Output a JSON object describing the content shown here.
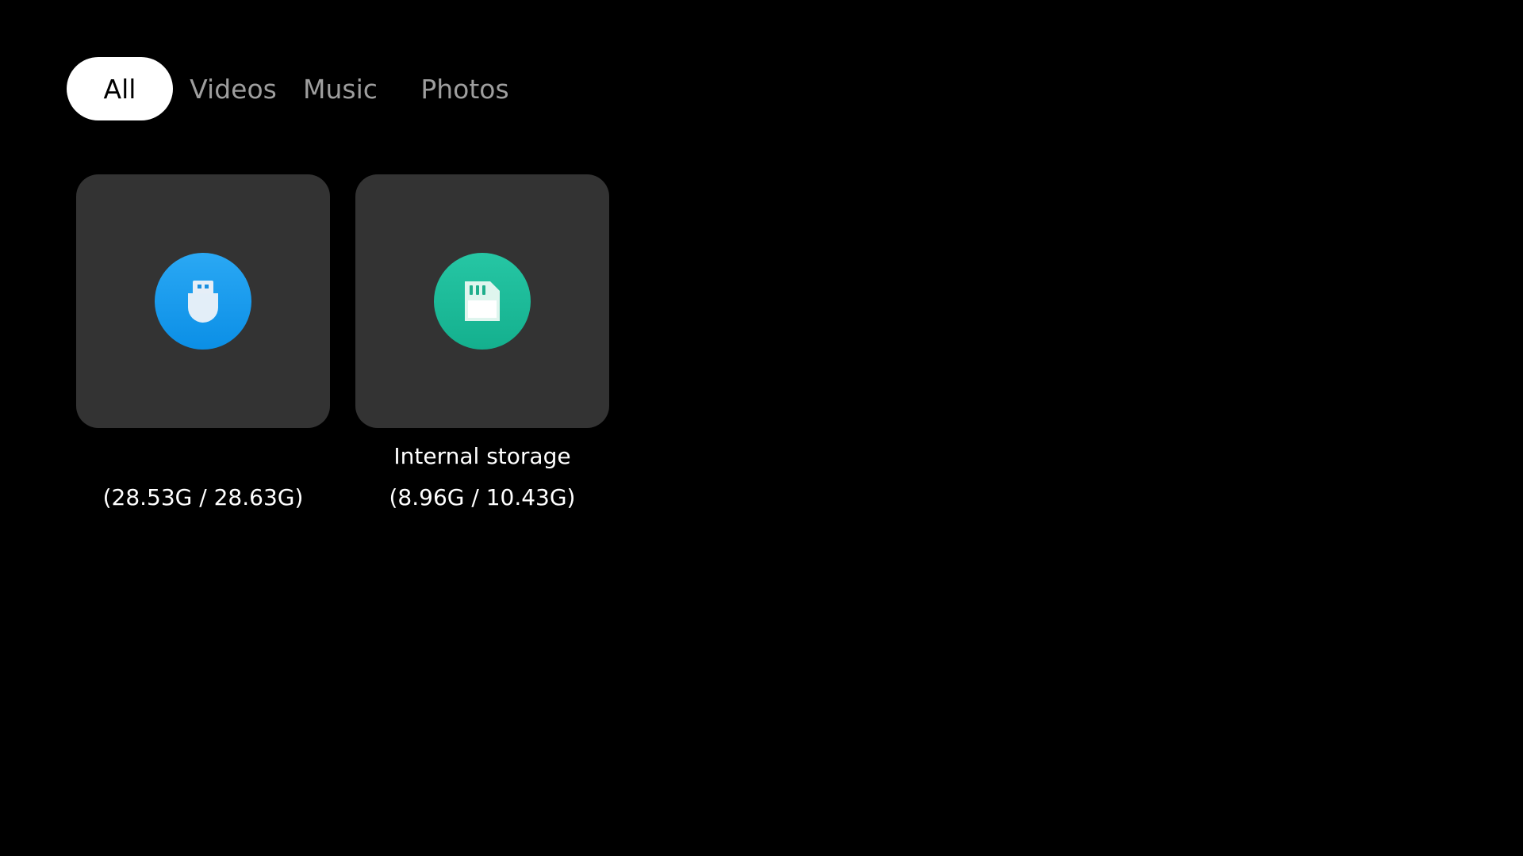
{
  "tabs": [
    {
      "label": "All",
      "selected": true
    },
    {
      "label": "Videos",
      "selected": false
    },
    {
      "label": "Music",
      "selected": false
    },
    {
      "label": "Photos",
      "selected": false
    }
  ],
  "storages": [
    {
      "icon": "usb-drive-icon",
      "name": "",
      "size": "(28.53G / 28.63G)",
      "accent": "#1a9bee"
    },
    {
      "icon": "sd-card-icon",
      "name": "Internal storage",
      "size": "(8.96G / 10.43G)",
      "accent": "#1fbc9a"
    }
  ],
  "colors": {
    "background": "#000000",
    "card": "#333333",
    "tab_selected_bg": "#ffffff",
    "tab_inactive_text": "#9e9e9e"
  }
}
